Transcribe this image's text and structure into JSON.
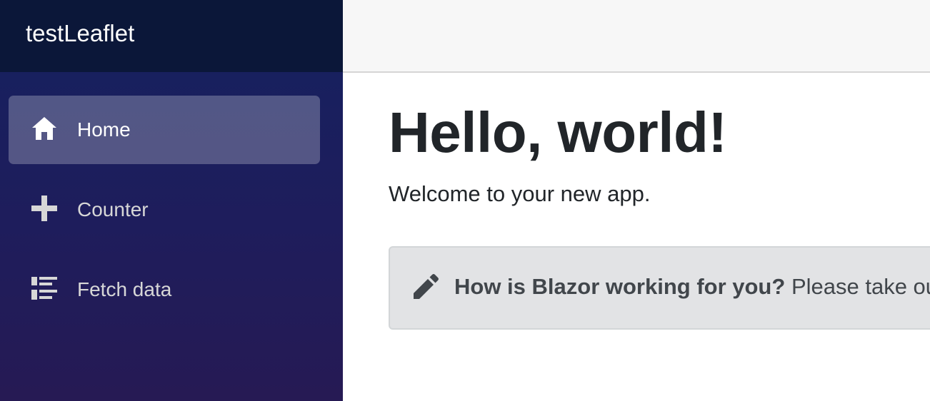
{
  "sidebar": {
    "brand": "testLeaflet",
    "items": [
      {
        "label": "Home",
        "icon": "home-icon",
        "active": true
      },
      {
        "label": "Counter",
        "icon": "plus-icon",
        "active": false
      },
      {
        "label": "Fetch data",
        "icon": "list-rich-icon",
        "active": false
      }
    ]
  },
  "main": {
    "title": "Hello, world!",
    "welcome": "Welcome to your new app.",
    "survey": {
      "icon": "pencil-icon",
      "question": "How is Blazor working for you?",
      "prompt": "Please take our"
    }
  },
  "colors": {
    "sidebar_top": "#0b1739",
    "sidebar_gradient_start": "#15215f",
    "sidebar_gradient_end": "#261a54",
    "alert_bg": "#e2e3e5",
    "top_row_bg": "#f7f7f7"
  }
}
